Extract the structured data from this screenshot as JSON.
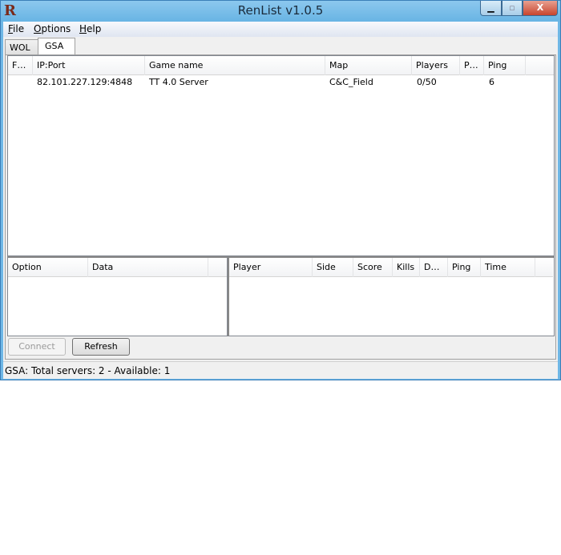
{
  "window": {
    "title": "RenList v1.0.5",
    "minimize": "▁",
    "maximize": "▫",
    "close": "X"
  },
  "menu": [
    {
      "label": "File",
      "accel": "F",
      "rest": "ile"
    },
    {
      "label": "Options",
      "accel": "O",
      "rest": "ptions"
    },
    {
      "label": "Help",
      "accel": "H",
      "rest": "elp"
    }
  ],
  "tabs": [
    {
      "label": "WOL",
      "selected": false
    },
    {
      "label": "GSA",
      "selected": true
    }
  ],
  "servers": {
    "columns": [
      "F…",
      "IP:Port",
      "Game name",
      "Map",
      "Players",
      "P…",
      "Ping"
    ],
    "rows": [
      {
        "flag": "",
        "ip": "82.101.227.129:4848",
        "name": "TT 4.0 Server",
        "map": "C&C_Field",
        "players": "0/50",
        "p": "",
        "ping": "6"
      }
    ]
  },
  "options": {
    "columns": [
      "Option",
      "Data"
    ]
  },
  "players": {
    "columns": [
      "Player",
      "Side",
      "Score",
      "Kills",
      "D…",
      "Ping",
      "Time"
    ]
  },
  "buttons": {
    "connect": "Connect",
    "refresh": "Refresh",
    "connect_enabled": false
  },
  "status": "GSA: Total servers: 2 - Available: 1"
}
